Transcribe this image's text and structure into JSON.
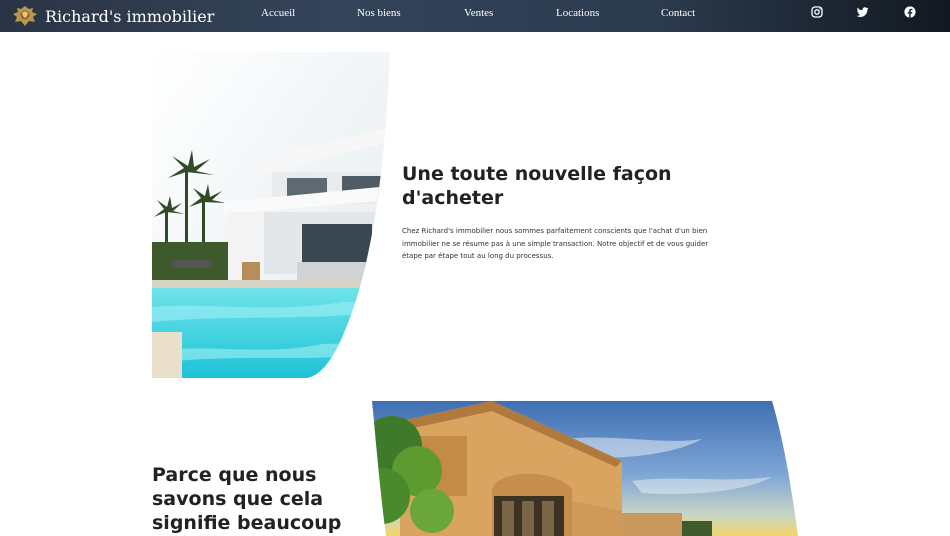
{
  "brand": {
    "name": "Richard's immobilier"
  },
  "nav": {
    "items": [
      {
        "label": "Accueil"
      },
      {
        "label": "Nos biens"
      },
      {
        "label": "Ventes"
      },
      {
        "label": "Locations"
      },
      {
        "label": "Contact"
      }
    ]
  },
  "social": {
    "icons": [
      "instagram-icon",
      "twitter-icon",
      "facebook-icon"
    ]
  },
  "hero": {
    "title": "Une toute nouvelle façon d'acheter",
    "description": "Chez Richard's immobilier nous sommes parfaitement conscients que l'achat d'un bien immobilier ne se résume pas à une simple transaction. Notre objectif et de vous guider étape par étape tout au long du processus."
  },
  "second": {
    "title": "Parce que nous savons que cela signifie beaucoup pour vous"
  },
  "colors": {
    "header_start": "#2a3444",
    "header_end": "#121820",
    "pool": "#3fd4e0",
    "sky": "#5f8fc8",
    "villa_wall": "#d9a45f"
  }
}
